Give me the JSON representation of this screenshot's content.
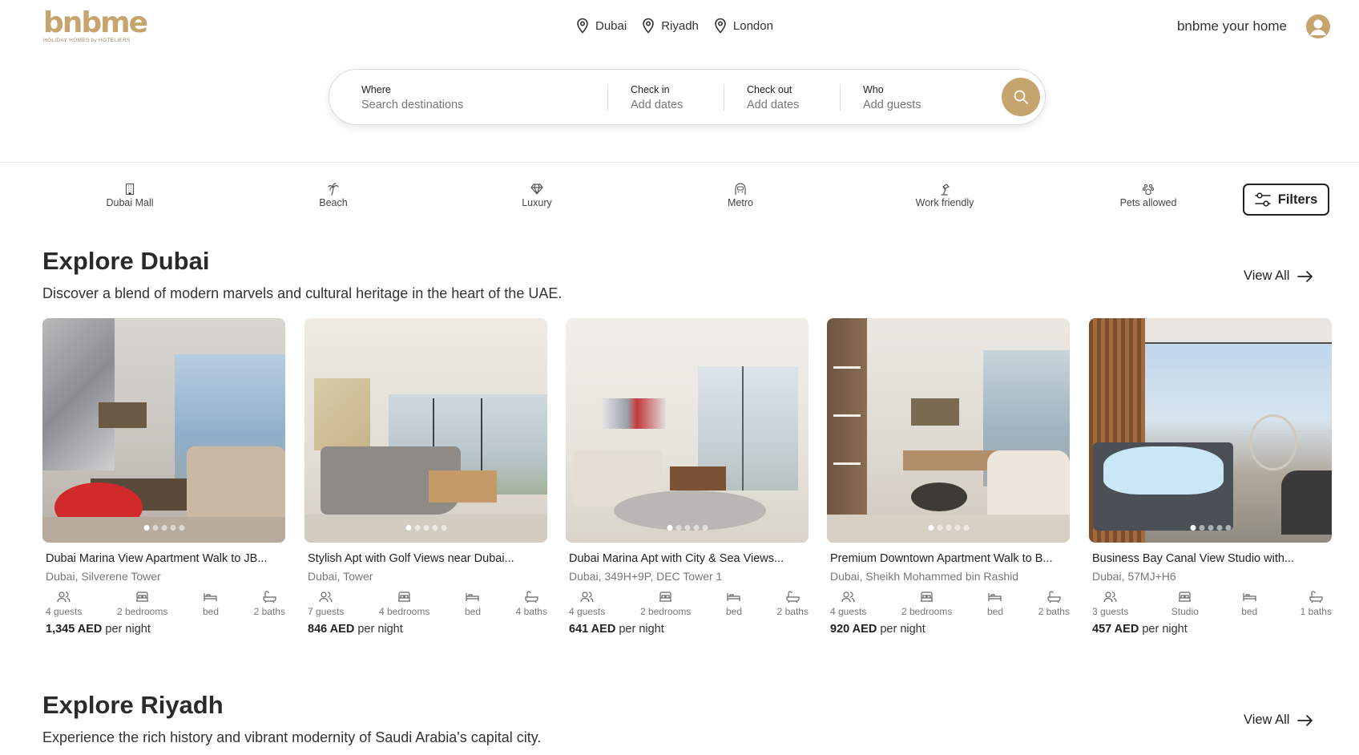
{
  "brand": {
    "name": "bnbme",
    "tagline": "HOLIDAY HOMES by HOTELIERS",
    "accent": "#c5a46d"
  },
  "nav": {
    "cities": [
      {
        "label": "Dubai",
        "icon": "map-pin-icon"
      },
      {
        "label": "Riyadh",
        "icon": "map-pin-icon"
      },
      {
        "label": "London",
        "icon": "map-pin-icon"
      }
    ],
    "host_link": "bnbme your home"
  },
  "search": {
    "where_label": "Where",
    "where_placeholder": "Search destinations",
    "checkin_label": "Check in",
    "checkin_placeholder": "Add dates",
    "checkout_label": "Check out",
    "checkout_placeholder": "Add dates",
    "who_label": "Who",
    "who_placeholder": "Add guests",
    "button_icon": "search-icon"
  },
  "categories": [
    {
      "label": "Dubai Mall",
      "icon": "building-icon"
    },
    {
      "label": "Beach",
      "icon": "palm-tree-icon"
    },
    {
      "label": "Luxury",
      "icon": "diamond-icon"
    },
    {
      "label": "Metro",
      "icon": "metro-icon"
    },
    {
      "label": "Work friendly",
      "icon": "desk-lamp-icon"
    },
    {
      "label": "Pets allowed",
      "icon": "paw-icon"
    }
  ],
  "filters_label": "Filters",
  "sections": [
    {
      "title": "Explore Dubai",
      "subtitle": "Discover a blend of modern marvels and cultural heritage in the heart of the UAE.",
      "view_all": "View All",
      "listings": [
        {
          "title": "Dubai Marina View Apartment Walk to JB...",
          "location": "Dubai, Silverene Tower",
          "guests": "4 guests",
          "rooms": "2 bedrooms",
          "bed": "bed",
          "baths": "2 baths",
          "price": "1,345 AED",
          "price_suffix": "per night"
        },
        {
          "title": "Stylish Apt with Golf Views near Dubai...",
          "location": "Dubai, Tower",
          "guests": "7 guests",
          "rooms": "4 bedrooms",
          "bed": "bed",
          "baths": "4 baths",
          "price": "846 AED",
          "price_suffix": "per night"
        },
        {
          "title": "Dubai Marina Apt with City & Sea Views...",
          "location": "Dubai, 349H+9P, DEC Tower 1",
          "guests": "4 guests",
          "rooms": "2 bedrooms",
          "bed": "bed",
          "baths": "2 baths",
          "price": "641 AED",
          "price_suffix": "per night"
        },
        {
          "title": "Premium Downtown Apartment Walk to B...",
          "location": "Dubai, Sheikh Mohammed bin Rashid",
          "guests": "4 guests",
          "rooms": "2 bedrooms",
          "bed": "bed",
          "baths": "2 baths",
          "price": "920 AED",
          "price_suffix": "per night"
        },
        {
          "title": "Business Bay Canal View Studio with...",
          "location": "Dubai, 57MJ+H6",
          "guests": "3 guests",
          "rooms": "Studio",
          "bed": "bed",
          "baths": "1 baths",
          "price": "457 AED",
          "price_suffix": "per night"
        }
      ]
    },
    {
      "title": "Explore Riyadh",
      "subtitle": "Experience the rich history and vibrant modernity of Saudi Arabia's capital city.",
      "view_all": "View All"
    }
  ]
}
